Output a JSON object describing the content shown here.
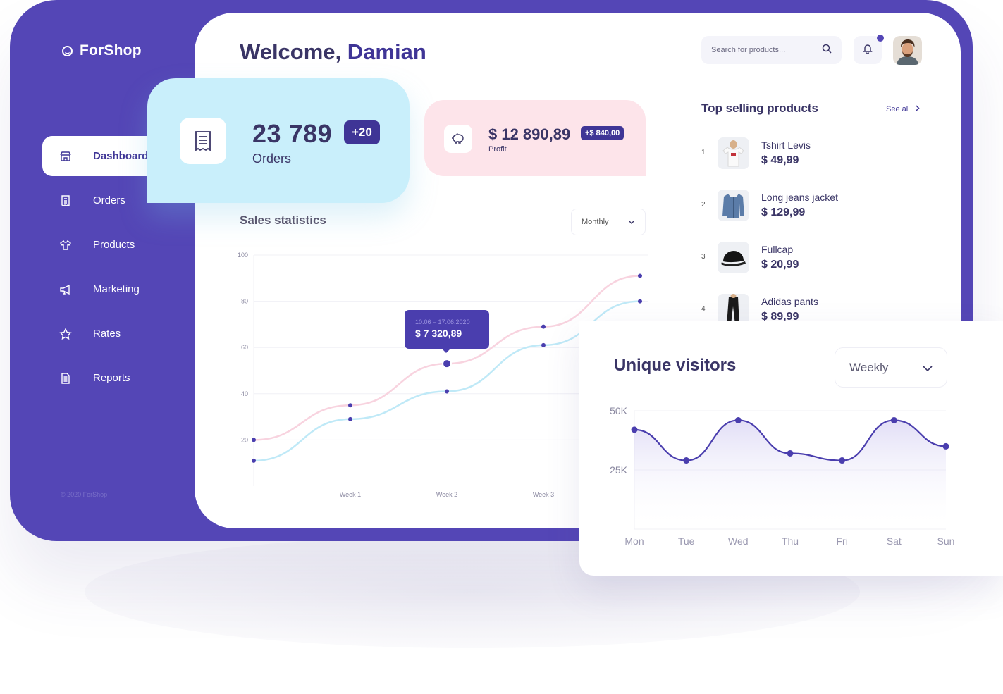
{
  "brand": {
    "name": "ForShop"
  },
  "sidebar": {
    "items": [
      {
        "label": "Dashboard",
        "icon": "store-icon",
        "active": true
      },
      {
        "label": "Orders",
        "icon": "receipt-icon"
      },
      {
        "label": "Products",
        "icon": "tshirt-icon"
      },
      {
        "label": "Marketing",
        "icon": "megaphone-icon"
      },
      {
        "label": "Rates",
        "icon": "star-icon"
      },
      {
        "label": "Reports",
        "icon": "report-icon"
      }
    ],
    "copyright": "© 2020 ForShop"
  },
  "header": {
    "welcome_prefix": "Welcome,",
    "welcome_name": "Damian",
    "search_placeholder": "Search for products...",
    "notification_icon": "bell-icon"
  },
  "orders_card": {
    "value": "23 789",
    "badge": "+20",
    "label": "Orders"
  },
  "profit_card": {
    "value": "$ 12 890,89",
    "badge": "+$ 840,00",
    "label": "Profit"
  },
  "sales": {
    "title": "Sales statistics",
    "period": "Monthly",
    "tooltip_range": "10.06 – 17.06.2020",
    "tooltip_value": "$ 7 320,89"
  },
  "top_products": {
    "title": "Top selling products",
    "see_all": "See all",
    "items": [
      {
        "rank": "1",
        "name": "Tshirt Levis",
        "price": "$ 49,99"
      },
      {
        "rank": "2",
        "name": "Long jeans jacket",
        "price": "$ 129,99"
      },
      {
        "rank": "3",
        "name": "Fullcap",
        "price": "$ 20,99"
      },
      {
        "rank": "4",
        "name": "Adidas pants",
        "price": "$ 89,99"
      }
    ]
  },
  "visitors": {
    "title": "Unique visitors",
    "period": "Weekly"
  },
  "colors": {
    "brand": "#5446b6",
    "accent": "#3f3596",
    "orders_bg": "#c9effb",
    "profit_bg": "#fde4ea"
  },
  "chart_data": [
    {
      "type": "line",
      "title": "Sales statistics",
      "categories": [
        "",
        "Week 1",
        "Week 2",
        "Week 3",
        ""
      ],
      "x_ticks": [
        "Week 1",
        "Week 2",
        "Week 3"
      ],
      "y_ticks": [
        20,
        40,
        60,
        80,
        100
      ],
      "ylim": [
        0,
        100
      ],
      "series": [
        {
          "values": [
            20,
            35,
            53,
            69,
            91
          ]
        },
        {
          "values": [
            11,
            29,
            41,
            61,
            80
          ]
        }
      ],
      "grid": true
    },
    {
      "type": "area",
      "title": "Unique visitors",
      "categories": [
        "Mon",
        "Tue",
        "Wed",
        "Thu",
        "Fri",
        "Sat",
        "Sun"
      ],
      "y_ticks": [
        "25K",
        "50K"
      ],
      "ylim": [
        0,
        50000
      ],
      "values": [
        42000,
        29000,
        46000,
        32000,
        29000,
        46000,
        35000
      ],
      "grid": true
    }
  ]
}
